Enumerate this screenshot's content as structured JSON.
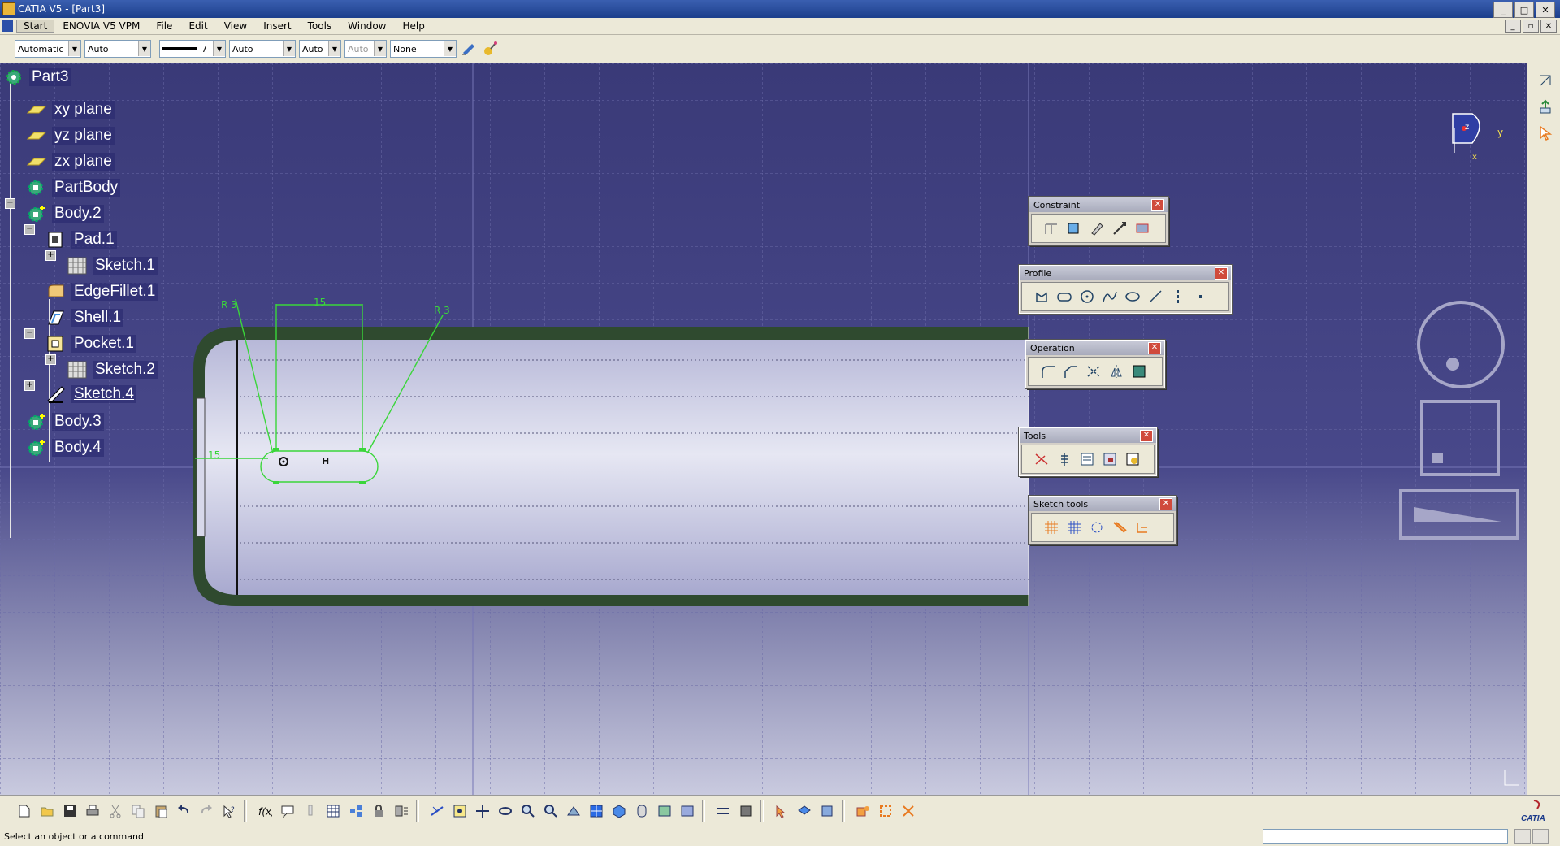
{
  "window": {
    "title": "CATIA V5 - [Part3]",
    "buttons": [
      "_",
      "□",
      "✕"
    ]
  },
  "menu": [
    "Start",
    "ENOVIA V5 VPM",
    "File",
    "Edit",
    "View",
    "Insert",
    "Tools",
    "Window",
    "Help"
  ],
  "properties": {
    "fill_color": "Automatic",
    "transparency": "Auto",
    "line_thickness": "7",
    "line_type": "Auto",
    "layer_a": "Auto",
    "layer_b": "Auto",
    "render_style": "None"
  },
  "tree": {
    "root": "Part3",
    "items": [
      "xy plane",
      "yz plane",
      "zx plane",
      "PartBody",
      "Body.2",
      "Pad.1",
      "Sketch.1",
      "EdgeFillet.1",
      "Shell.1",
      "Pocket.1",
      "Sketch.2",
      "Sketch.4",
      "Body.3",
      "Body.4"
    ]
  },
  "sketch": {
    "dim_radius_left": "R 3",
    "dim_radius_right": "R 3",
    "dim_length": "15",
    "dim_offset": "15",
    "constraint_h": "H"
  },
  "toolbars": {
    "constraint": "Constraint",
    "profile": "Profile",
    "operation": "Operation",
    "tools": "Tools",
    "sketch_tools": "Sketch tools"
  },
  "compass": {
    "axis_y": "y",
    "axis_x": "x",
    "axis_z": "z"
  },
  "status": {
    "message": "Select an object or a command"
  },
  "colors": {
    "viewport_top": "#3a3a78",
    "sketch_green": "#3ad63a",
    "part_edge": "#2f4a2f"
  }
}
